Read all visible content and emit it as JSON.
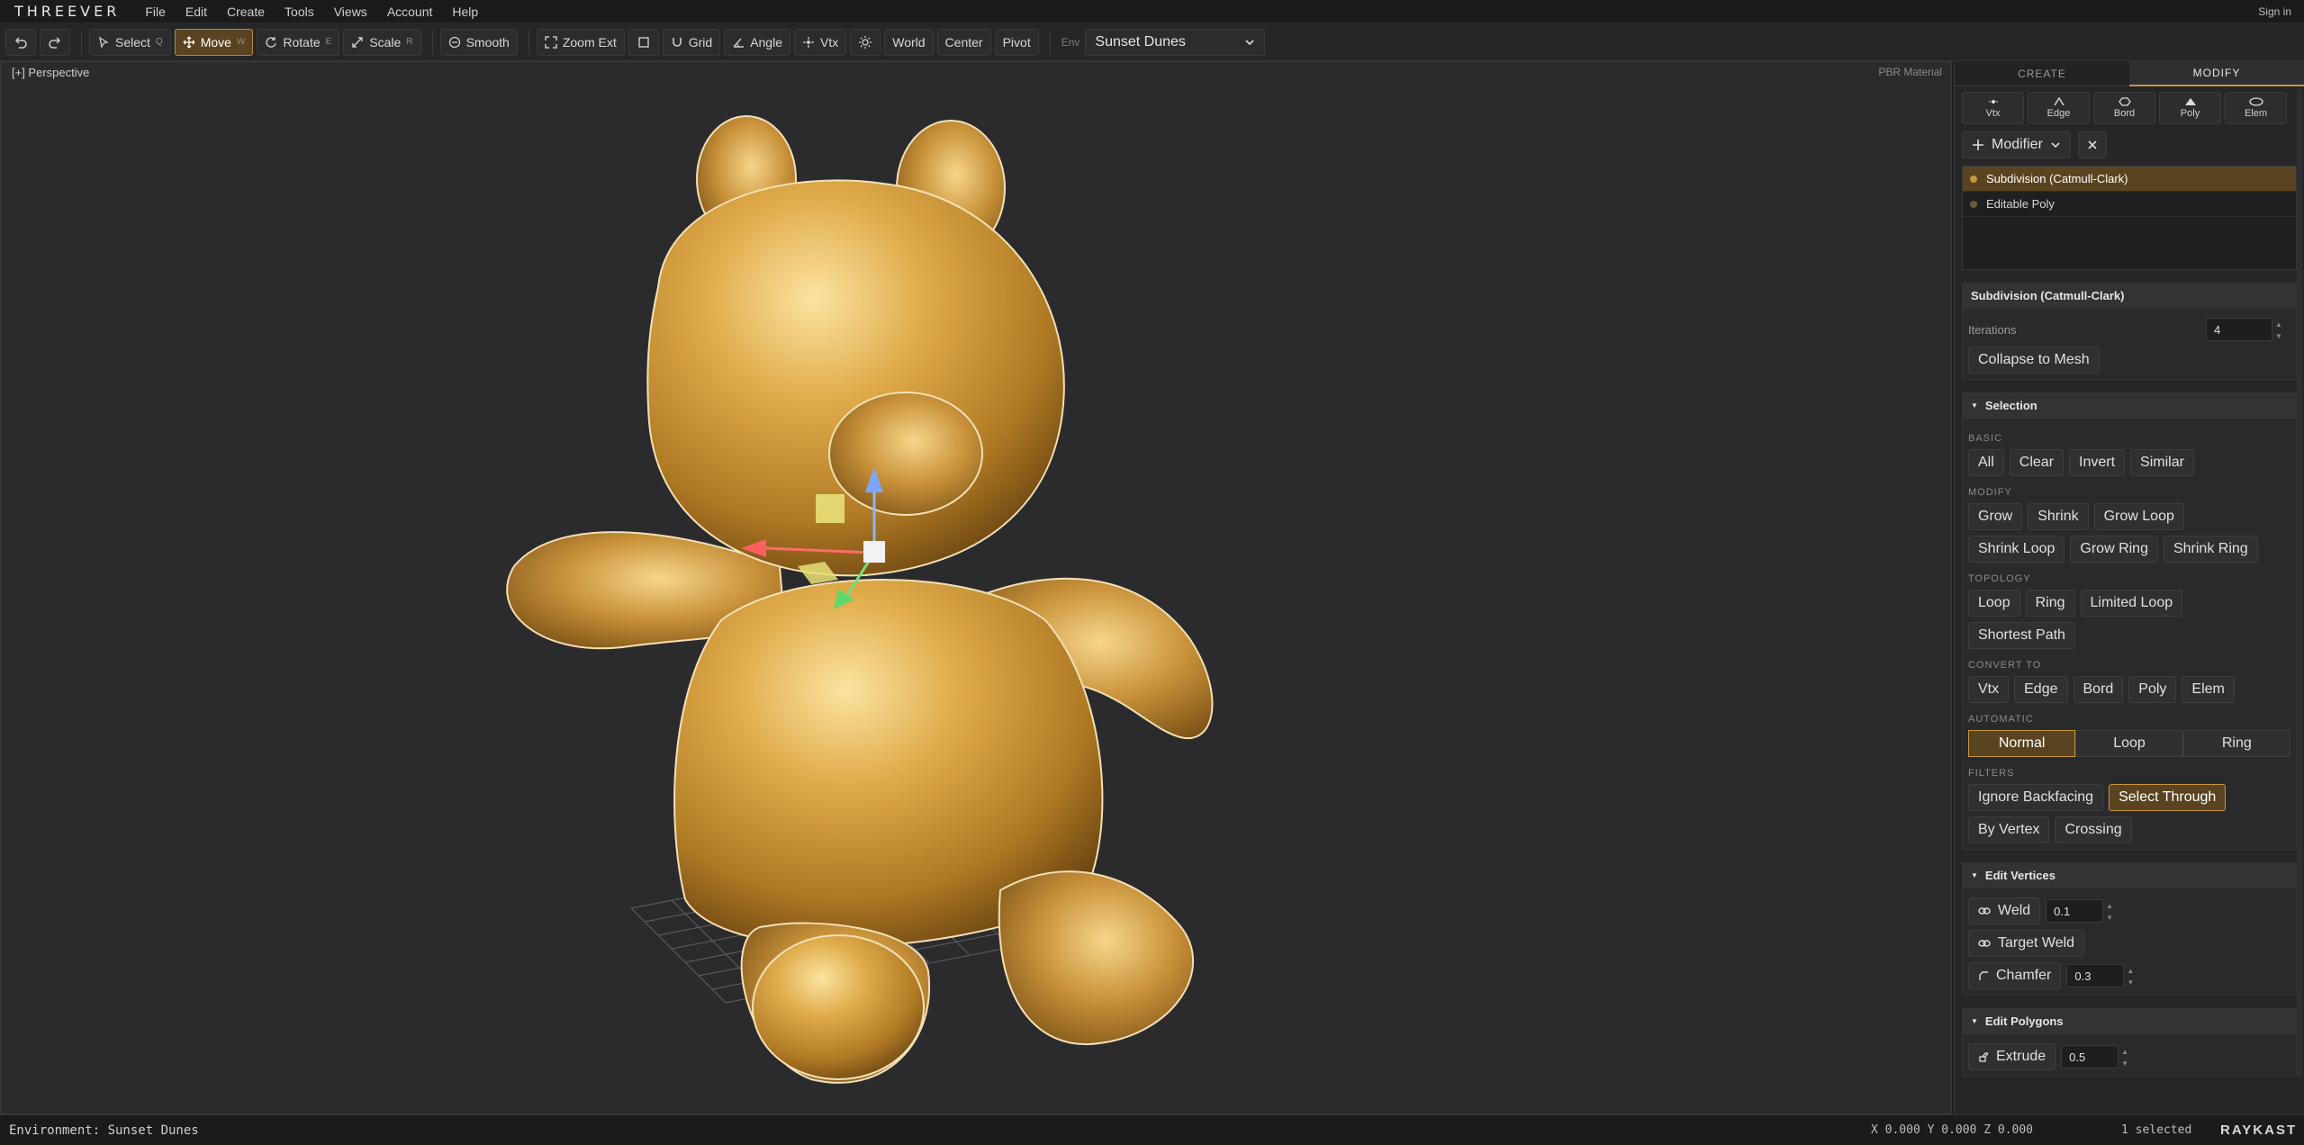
{
  "app": {
    "logo": "THREEVER",
    "signin": "Sign in"
  },
  "menu": [
    "File",
    "Edit",
    "Create",
    "Tools",
    "Views",
    "Account",
    "Help"
  ],
  "toolbar": {
    "select": {
      "label": "Select",
      "key": "Q"
    },
    "move": {
      "label": "Move",
      "key": "W"
    },
    "rotate": {
      "label": "Rotate",
      "key": "E"
    },
    "scale": {
      "label": "Scale",
      "key": "R"
    },
    "smooth": "Smooth",
    "zoom_ext": "Zoom Ext",
    "grid": "Grid",
    "angle": "Angle",
    "vtx": "Vtx",
    "world": "World",
    "center": "Center",
    "pivot": "Pivot",
    "env_label": "Env",
    "env_value": "Sunset Dunes"
  },
  "viewport": {
    "label": "[+] Perspective",
    "material": "PBR Material"
  },
  "panel": {
    "tabs": [
      "CREATE",
      "MODIFY"
    ],
    "subobjects": [
      "Vtx",
      "Edge",
      "Bord",
      "Poly",
      "Elem"
    ],
    "modifier_btn": "Modifier",
    "stack": [
      "Subdivision (Catmull-Clark)",
      "Editable Poly"
    ],
    "subdiv": {
      "title": "Subdivision (Catmull-Clark)",
      "iterations_label": "Iterations",
      "iterations": "4",
      "collapse": "Collapse to Mesh"
    },
    "selection": {
      "title": "Selection",
      "basic_label": "BASIC",
      "basic": [
        "All",
        "Clear",
        "Invert",
        "Similar"
      ],
      "modify_label": "MODIFY",
      "modify_row1": [
        "Grow",
        "Shrink",
        "Grow Loop"
      ],
      "modify_row2": [
        "Shrink Loop",
        "Grow Ring",
        "Shrink Ring"
      ],
      "topology_label": "TOPOLOGY",
      "topology_row1": [
        "Loop",
        "Ring",
        "Limited Loop"
      ],
      "topology_row2": [
        "Shortest Path"
      ],
      "convert_label": "CONVERT TO",
      "convert": [
        "Vtx",
        "Edge",
        "Bord",
        "Poly",
        "Elem"
      ],
      "automatic_label": "AUTOMATIC",
      "automatic": [
        "Normal",
        "Loop",
        "Ring"
      ],
      "filters_label": "FILTERS",
      "filters_row1": [
        "Ignore Backfacing",
        "Select Through"
      ],
      "filters_row2": [
        "By Vertex",
        "Crossing"
      ]
    },
    "edit_vertices": {
      "title": "Edit Vertices",
      "weld": "Weld",
      "weld_val": "0.1",
      "target_weld": "Target Weld",
      "chamfer": "Chamfer",
      "chamfer_val": "0.3"
    },
    "edit_polygons": {
      "title": "Edit Polygons",
      "extrude": "Extrude",
      "extrude_val": "0.5"
    }
  },
  "status": {
    "env": "Environment: Sunset Dunes",
    "coords": "X 0.000  Y 0.000  Z 0.000",
    "selected": "1 selected",
    "brand": "RAYKAST"
  },
  "colors": {
    "accent": "#c9963f",
    "active_bg": "#5a4320",
    "gold": "#d9a441"
  }
}
